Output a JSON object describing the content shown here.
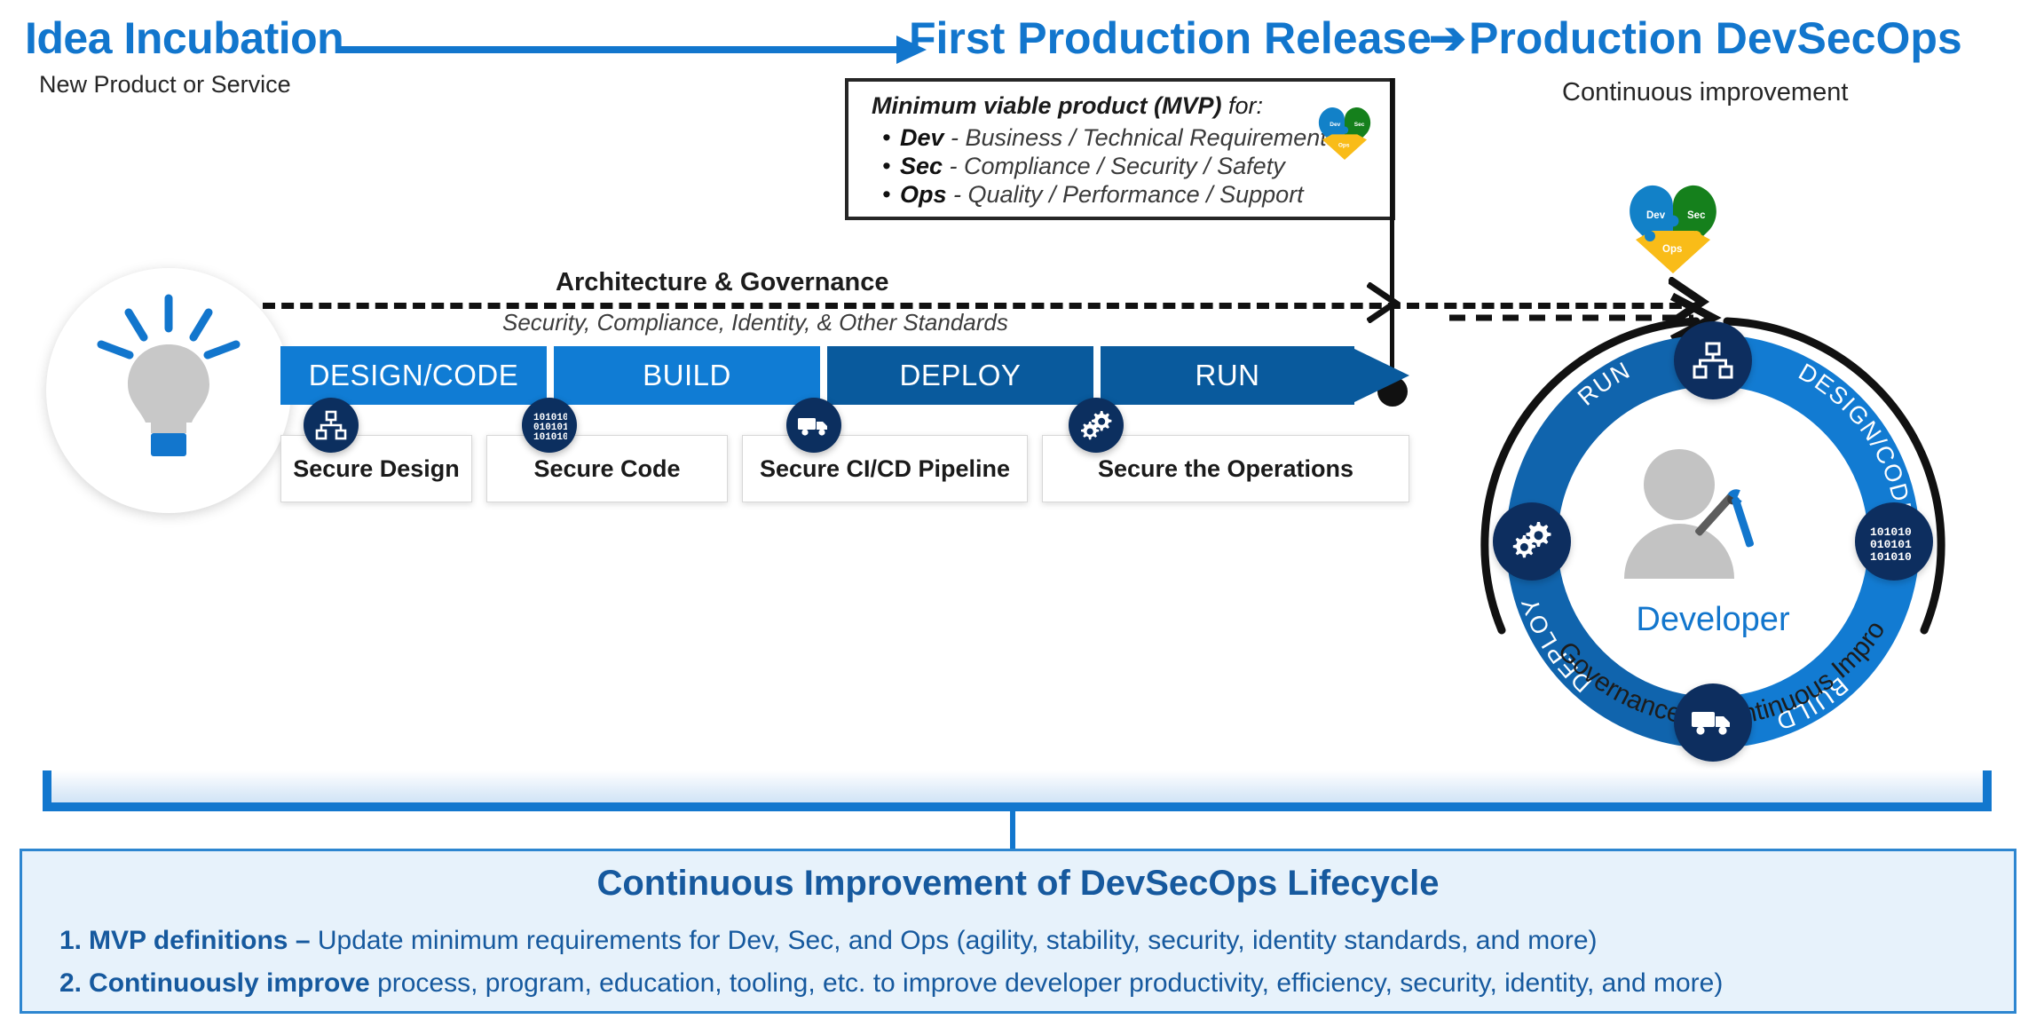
{
  "header": {
    "idea_title": "Idea Incubation",
    "idea_subtitle": "New Product or Service",
    "first_release_title": "First Production Release",
    "arrow_glyph": "➔",
    "production_title": "Production DevSecOps",
    "production_subtitle": "Continuous improvement"
  },
  "mvp": {
    "title_bold": "Minimum viable product (MVP)",
    "title_rest": " for:",
    "items": [
      {
        "bullet": "•",
        "term": "Dev",
        "desc": " - Business / Technical Requirements"
      },
      {
        "bullet": "•",
        "term": "Sec",
        "desc": " - Compliance / Security / Safety"
      },
      {
        "bullet": "•",
        "term": "Ops",
        "desc": " - Quality / Performance / Support"
      }
    ]
  },
  "heart": {
    "dev": "Dev",
    "sec": "Sec",
    "ops": "Ops",
    "dev_color": "#1281c8",
    "sec_color": "#15801c",
    "ops_color": "#f9bc18"
  },
  "governance": {
    "title": "Architecture & Governance",
    "subtitle": "Security, Compliance, Identity, & Other Standards"
  },
  "pipeline": {
    "stages": [
      {
        "label": "DESIGN/CODE",
        "tone": "light",
        "color": "#107cd4"
      },
      {
        "label": "BUILD",
        "tone": "light",
        "color": "#107cd4"
      },
      {
        "label": "DEPLOY",
        "tone": "dark",
        "color": "#095a9d"
      },
      {
        "label": "RUN",
        "tone": "dark",
        "color": "#095a9d"
      }
    ],
    "secure_boxes": [
      {
        "label": "Secure Design",
        "icon": "sitemap-icon"
      },
      {
        "label": "Secure Code",
        "icon": "binary-code-icon"
      },
      {
        "label": "Secure CI/CD Pipeline",
        "icon": "delivery-truck-icon"
      },
      {
        "label": "Secure the Operations",
        "icon": "gears-icon"
      }
    ]
  },
  "wheel": {
    "segments": [
      {
        "label": "DESIGN/CODE",
        "color": "#127bd2"
      },
      {
        "label": "BUILD",
        "color": "#127bd2"
      },
      {
        "label": "DEPLOY",
        "color": "#1064ad"
      },
      {
        "label": "RUN",
        "color": "#1064ad"
      }
    ],
    "center_label": "Developer",
    "outer_label": "Governance – Continuous Improvement",
    "icons": [
      "sitemap-icon",
      "binary-code-icon",
      "delivery-truck-icon",
      "gears-icon"
    ]
  },
  "panel": {
    "title": "Continuous Improvement of DevSecOps Lifecycle",
    "items": [
      {
        "num": "1.",
        "bold": "MVP definitions – ",
        "text": "Update minimum requirements for Dev, Sec, and Ops (agility, stability, security, identity standards, and more)"
      },
      {
        "num": "2.",
        "bold": "Continuously improve ",
        "text": "process, program, education, tooling, etc. to improve developer productivity, efficiency, security, identity, and more)"
      }
    ]
  },
  "colors": {
    "brand_blue": "#1276cd",
    "deep_blue": "#0c2f5f",
    "panel_bg": "#e7f2fb",
    "panel_text": "#16599e",
    "dark_ink": "#111111"
  }
}
